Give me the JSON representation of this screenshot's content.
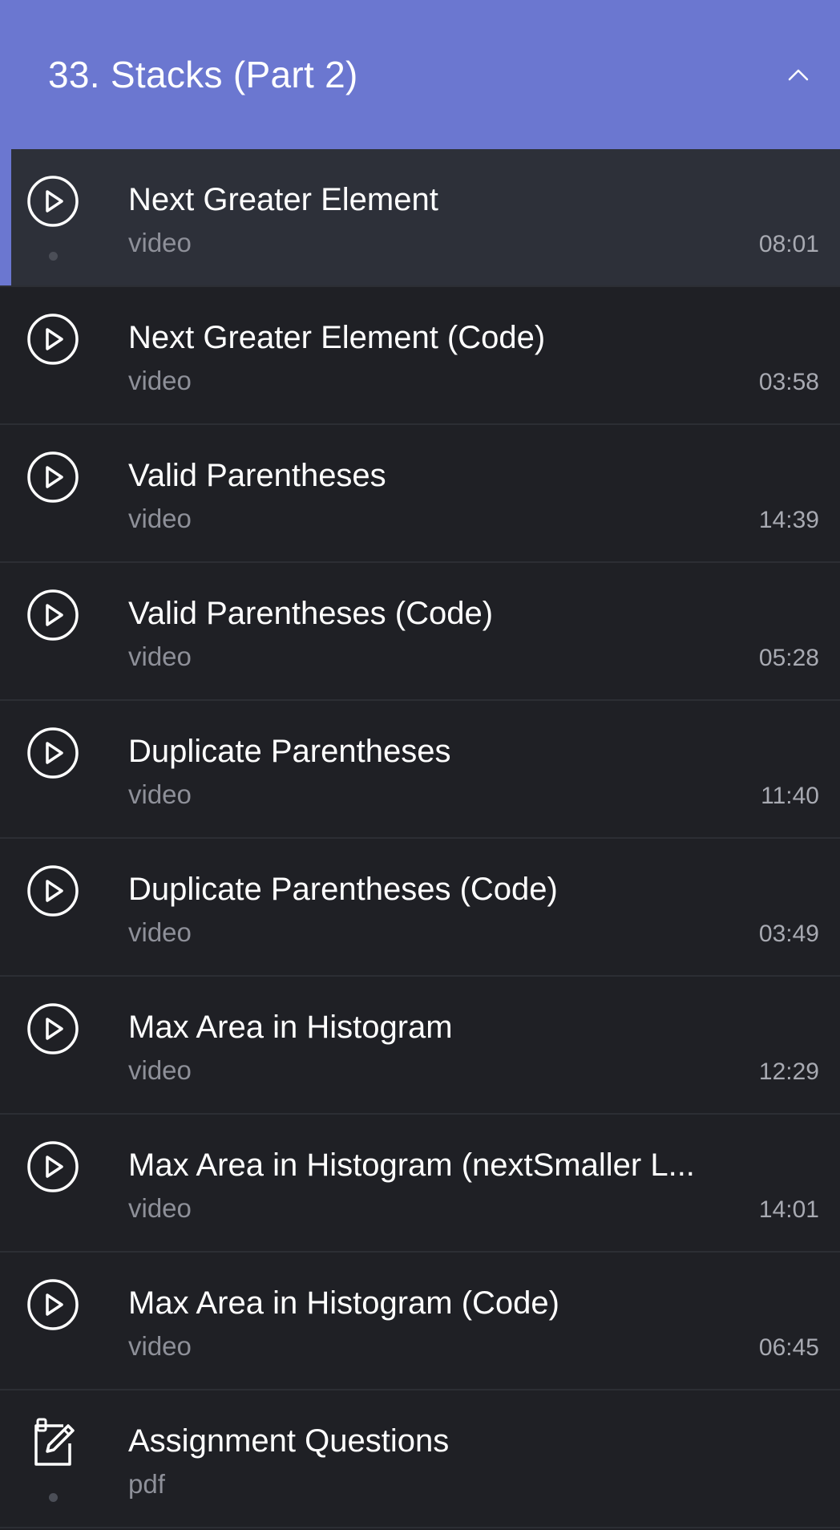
{
  "section": {
    "title": "33. Stacks (Part 2)",
    "chevron_icon": "chevron-up-icon"
  },
  "colors": {
    "header_bg": "#6b77d0",
    "page_bg": "#1f2025",
    "active_row_bg": "#2d3039",
    "active_indicator": "#6b77d0"
  },
  "lessons": [
    {
      "title": "Next Greater Element",
      "type": "video",
      "duration": "08:01",
      "icon": "play-circle-icon",
      "active": true
    },
    {
      "title": "Next Greater Element (Code)",
      "type": "video",
      "duration": "03:58",
      "icon": "play-circle-icon",
      "active": false
    },
    {
      "title": "Valid Parentheses",
      "type": "video",
      "duration": "14:39",
      "icon": "play-circle-icon",
      "active": false
    },
    {
      "title": "Valid Parentheses (Code)",
      "type": "video",
      "duration": "05:28",
      "icon": "play-circle-icon",
      "active": false
    },
    {
      "title": "Duplicate Parentheses",
      "type": "video",
      "duration": "11:40",
      "icon": "play-circle-icon",
      "active": false
    },
    {
      "title": "Duplicate Parentheses (Code)",
      "type": "video",
      "duration": "03:49",
      "icon": "play-circle-icon",
      "active": false
    },
    {
      "title": "Max Area in Histogram",
      "type": "video",
      "duration": "12:29",
      "icon": "play-circle-icon",
      "active": false
    },
    {
      "title": "Max Area in Histogram (nextSmaller L...",
      "type": "video",
      "duration": "14:01",
      "icon": "play-circle-icon",
      "active": false
    },
    {
      "title": "Max Area in Histogram (Code)",
      "type": "video",
      "duration": "06:45",
      "icon": "play-circle-icon",
      "active": false
    },
    {
      "title": "Assignment Questions",
      "type": "pdf",
      "duration": "",
      "icon": "edit-document-icon",
      "active": false
    }
  ]
}
